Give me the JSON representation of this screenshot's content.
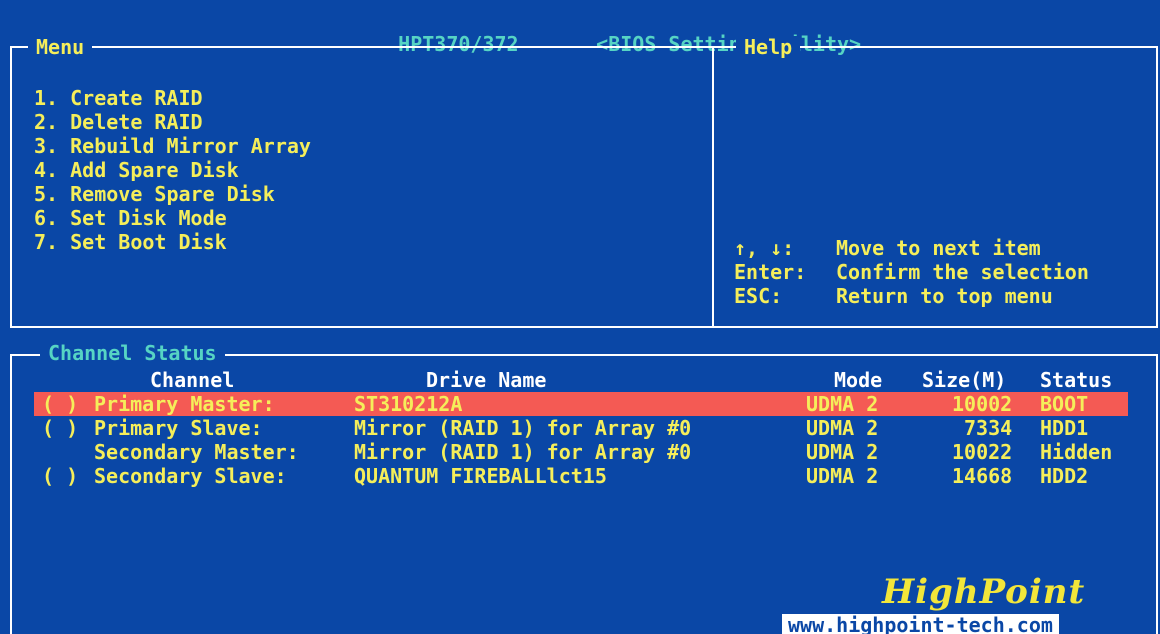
{
  "app": {
    "title": "HPT370/372",
    "subtitle": "<BIOS Setting Utility>"
  },
  "menu": {
    "legend": "Menu",
    "items": [
      {
        "label": "1. Create RAID"
      },
      {
        "label": "2. Delete RAID"
      },
      {
        "label": "3. Rebuild Mirror Array"
      },
      {
        "label": "4. Add Spare Disk"
      },
      {
        "label": "5. Remove Spare Disk"
      },
      {
        "label": "6. Set Disk Mode"
      },
      {
        "label": "7. Set Boot Disk"
      }
    ]
  },
  "help": {
    "legend": "Help",
    "keys": [
      {
        "key": "↑, ↓:",
        "desc": "Move to next item"
      },
      {
        "key": "Enter:",
        "desc": "Confirm the selection"
      },
      {
        "key": "ESC:",
        "desc": "Return to top menu"
      }
    ]
  },
  "channel_status": {
    "legend": "Channel Status",
    "headers": {
      "channel": "Channel",
      "drive": "Drive Name",
      "mode": "Mode",
      "size": "Size(M)",
      "status": "Status"
    },
    "rows": [
      {
        "check": "( )",
        "channel": "Primary Master:",
        "drive": "ST310212A",
        "mode": "UDMA 2",
        "size": "10002",
        "status": "BOOT"
      },
      {
        "check": "( )",
        "channel": "Primary Slave:",
        "drive": "Mirror (RAID 1) for Array #0",
        "mode": "UDMA 2",
        "size": "7334",
        "status": "HDD1"
      },
      {
        "check": "",
        "channel": "Secondary Master:",
        "drive": "Mirror (RAID 1) for Array #0",
        "mode": "UDMA 2",
        "size": "10022",
        "status": "Hidden"
      },
      {
        "check": "( )",
        "channel": "Secondary Slave:",
        "drive": "QUANTUM FIREBALLlct15",
        "mode": "UDMA 2",
        "size": "14668",
        "status": "HDD2"
      }
    ]
  },
  "branding": {
    "logo": "HighPoint",
    "url": "www.highpoint-tech.com"
  },
  "colors": {
    "background": "#0a47a6",
    "selection": "#f45a54",
    "text_yellow": "#f5ee5a",
    "text_cyan": "#56d4c4",
    "frame": "#ffffff"
  }
}
